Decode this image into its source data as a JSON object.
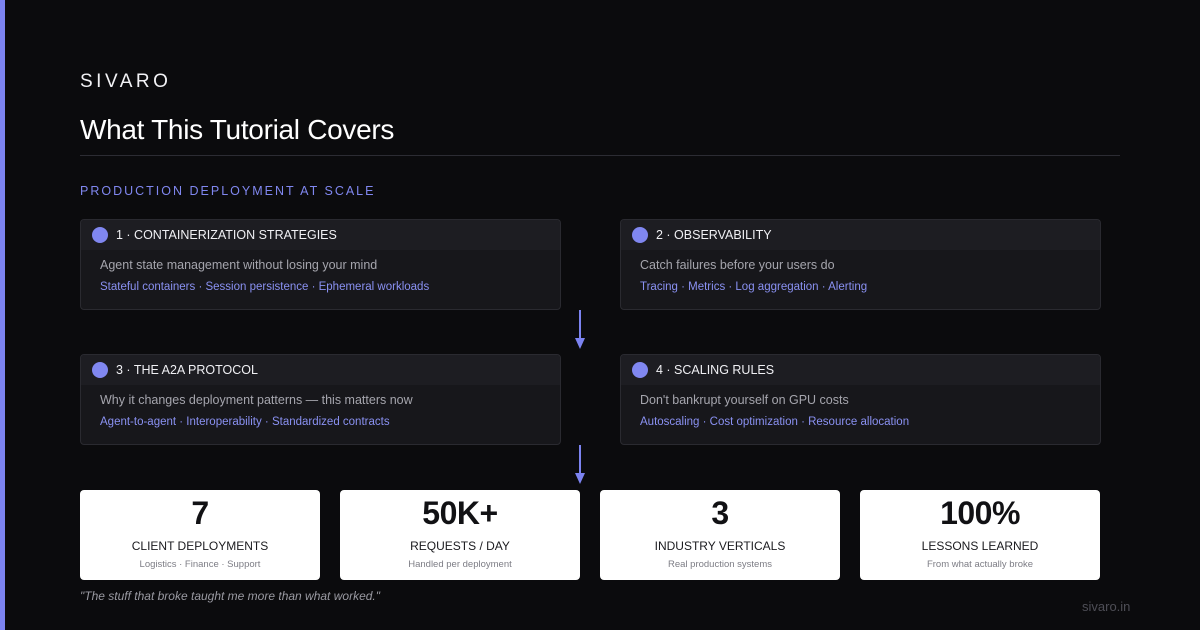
{
  "brand": "SIVARO",
  "title": "What This Tutorial Covers",
  "section_label": "PRODUCTION DEPLOYMENT AT SCALE",
  "accent_color": "#7c83f0",
  "cards": [
    {
      "title": "1 · CONTAINERIZATION STRATEGIES",
      "description": "Agent state management without losing your mind",
      "tags": "Stateful containers · Session persistence · Ephemeral workloads"
    },
    {
      "title": "2 · OBSERVABILITY",
      "description": "Catch failures before your users do",
      "tags": "Tracing · Metrics · Log aggregation · Alerting"
    },
    {
      "title": "3 · THE A2A PROTOCOL",
      "description": "Why it changes deployment patterns — this matters now",
      "tags": "Agent-to-agent · Interoperability · Standardized contracts"
    },
    {
      "title": "4 · SCALING RULES",
      "description": "Don't bankrupt yourself on GPU costs",
      "tags": "Autoscaling · Cost optimization · Resource allocation"
    }
  ],
  "stats": [
    {
      "value": "7",
      "label": "CLIENT DEPLOYMENTS",
      "sub": "Logistics · Finance · Support"
    },
    {
      "value": "50K+",
      "label": "REQUESTS / DAY",
      "sub": "Handled per deployment"
    },
    {
      "value": "3",
      "label": "INDUSTRY VERTICALS",
      "sub": "Real production systems"
    },
    {
      "value": "100%",
      "label": "LESSONS LEARNED",
      "sub": "From what actually broke"
    }
  ],
  "quote": "\"The stuff that broke taught me more than what worked.\"",
  "footer_url": "sivaro.in"
}
